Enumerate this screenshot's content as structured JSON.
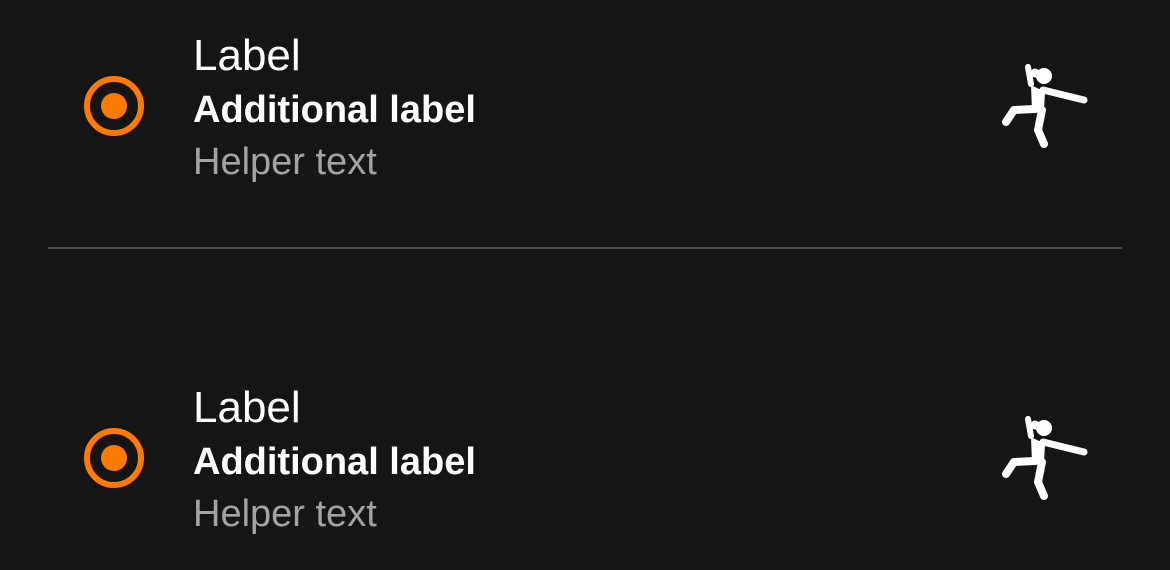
{
  "colors": {
    "background": "#151515",
    "accent": "#ff7a00",
    "primary_text": "#ffffff",
    "helper_text": "#a3a3a3",
    "divider": "#4a4a4a"
  },
  "items": [
    {
      "label": "Label",
      "additional_label": "Additional label",
      "helper_text": "Helper text",
      "selected": true,
      "icon": "handball-player-icon"
    },
    {
      "label": "Label",
      "additional_label": "Additional label",
      "helper_text": "Helper text",
      "selected": true,
      "icon": "handball-player-icon"
    }
  ]
}
